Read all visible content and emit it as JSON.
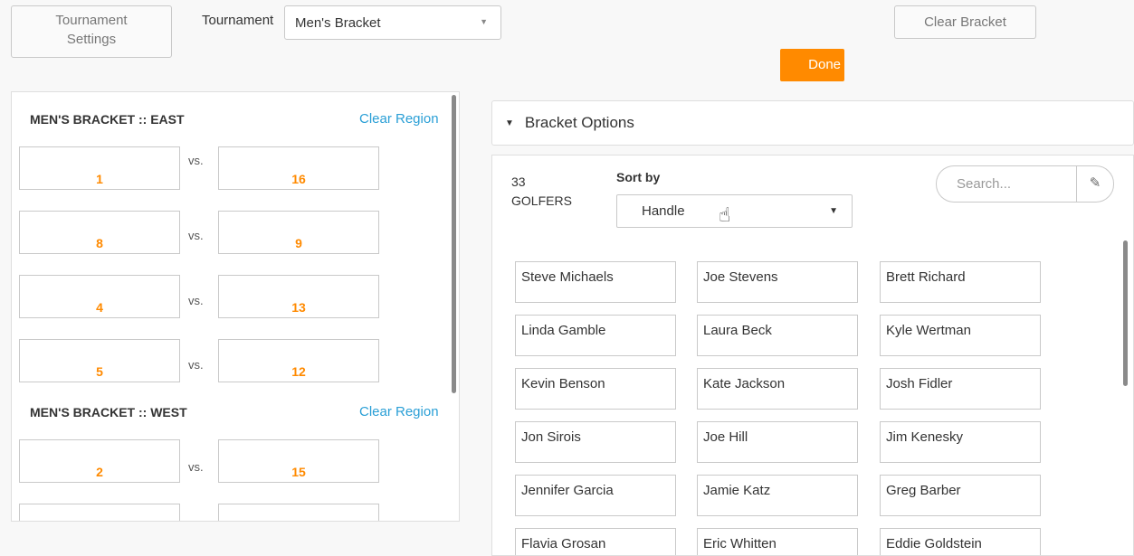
{
  "toolbar": {
    "settings_line1": "Tournament",
    "settings_line2": "Settings",
    "tournament_label": "Tournament",
    "tournament_value": "Men's Bracket",
    "clear_bracket": "Clear Bracket",
    "done": "Done"
  },
  "regions": [
    {
      "title": "MEN'S BRACKET :: EAST",
      "clear_label": "Clear Region",
      "matchups": [
        {
          "left": "1",
          "vs": "vs.",
          "right": "16"
        },
        {
          "left": "8",
          "vs": "vs.",
          "right": "9"
        },
        {
          "left": "4",
          "vs": "vs.",
          "right": "13"
        },
        {
          "left": "5",
          "vs": "vs.",
          "right": "12"
        }
      ]
    },
    {
      "title": "MEN'S BRACKET :: WEST",
      "clear_label": "Clear Region",
      "matchups": [
        {
          "left": "2",
          "vs": "vs.",
          "right": "15"
        },
        {
          "left": "",
          "vs": "",
          "right": ""
        }
      ]
    }
  ],
  "options": {
    "label": "Bracket Options"
  },
  "golfers": {
    "count_number": "33",
    "count_label": "GOLFERS",
    "sort_label": "Sort by",
    "sort_value": "Handle",
    "search_placeholder": "Search...",
    "grid": [
      [
        "Steve Michaels",
        "Joe Stevens",
        "Brett Richard"
      ],
      [
        "Linda Gamble",
        "Laura Beck",
        "Kyle Wertman"
      ],
      [
        "Kevin Benson",
        "Kate Jackson",
        "Josh Fidler"
      ],
      [
        "Jon Sirois",
        "Joe Hill",
        "Jim Kenesky"
      ],
      [
        "Jennifer Garcia",
        "Jamie Katz",
        "Greg Barber"
      ],
      [
        "Flavia Grosan",
        "Eric Whitten",
        "Eddie Goldstein"
      ]
    ]
  },
  "icons": {
    "dropdown": "caret-down-icon",
    "eraser": "eraser-icon",
    "cursor": "hand-pointer-icon",
    "collapse": "triangle-down-icon"
  },
  "colors": {
    "accent_orange": "#ff8a00",
    "link_blue": "#2a9fd6"
  }
}
